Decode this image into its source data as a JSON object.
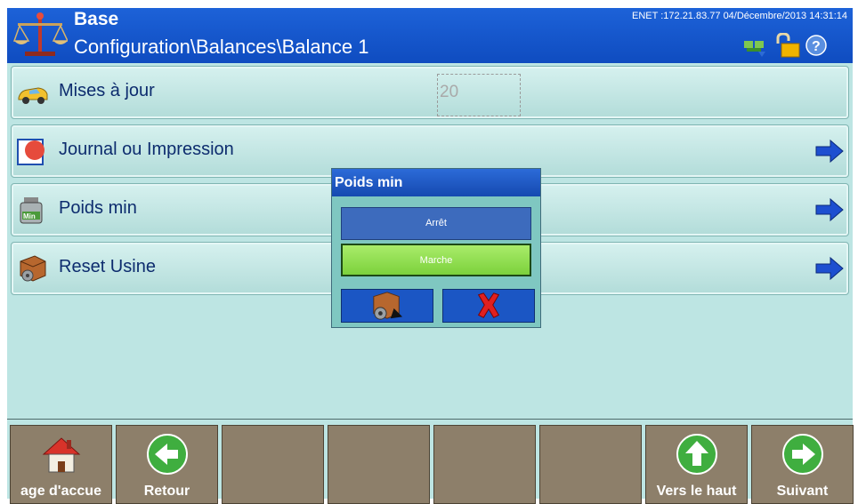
{
  "header": {
    "title": "Base",
    "path": "Configuration\\Balances\\Balance 1",
    "status": "ENET :172.21.83.77  04/Décembre/2013 14:31:14",
    "logo_icon": "scale-logo-icon",
    "status_icons": [
      "network-icon",
      "padlock-unlocked-icon",
      "help-icon"
    ]
  },
  "menu": {
    "items": [
      {
        "label": "Mises à jour",
        "icon": "car-icon",
        "value": "20"
      },
      {
        "label": "Journal ou Impression",
        "icon": "log-print-icon"
      },
      {
        "label": "Poids min",
        "icon": "min-weight-icon"
      },
      {
        "label": "Reset Usine",
        "icon": "factory-reset-icon"
      }
    ]
  },
  "dialog": {
    "title": "Poids min",
    "options": [
      "Arrêt",
      "Marche"
    ],
    "selected": "Marche",
    "ok_icon": "factory-reset-icon",
    "cancel_icon": "red-x-icon"
  },
  "softkeys": [
    {
      "label": "age d'accue",
      "icon": "home-icon"
    },
    {
      "label": "Retour",
      "icon": "back-arrow-icon"
    },
    {
      "label": "",
      "icon": ""
    },
    {
      "label": "",
      "icon": ""
    },
    {
      "label": "",
      "icon": ""
    },
    {
      "label": "",
      "icon": ""
    },
    {
      "label": "Vers le haut",
      "icon": "up-arrow-icon"
    },
    {
      "label": "Suivant",
      "icon": "next-arrow-icon"
    }
  ],
  "colors": {
    "header_blue": "#1558d0",
    "background": "#bde5e3",
    "softkey": "#8d7f6a",
    "option_selected": "#8fdf4f",
    "option_unselected": "#3d6bbd"
  }
}
